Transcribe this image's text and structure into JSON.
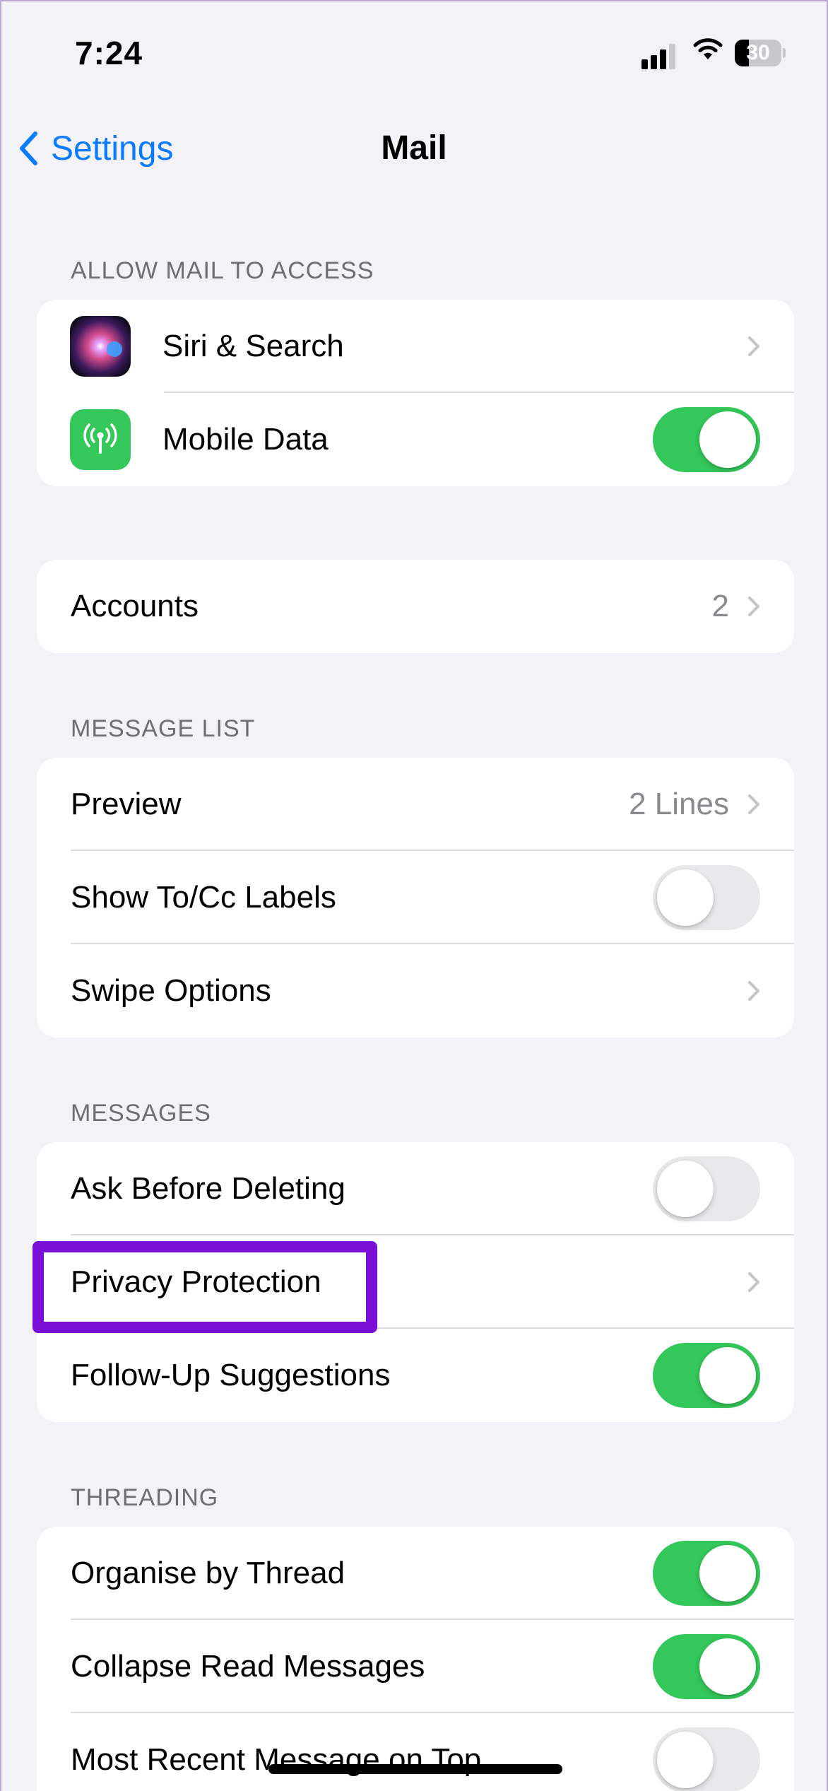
{
  "status_bar": {
    "time": "7:24",
    "battery_level": "30",
    "battery_fraction": 0.3,
    "signal_bars_active": 3,
    "signal_bars_total": 4
  },
  "nav": {
    "back_label": "Settings",
    "title": "Mail"
  },
  "sections": {
    "allow_access": {
      "header": "ALLOW MAIL TO ACCESS",
      "rows": [
        {
          "label": "Siri & Search",
          "icon": "siri-icon",
          "type": "chevron"
        },
        {
          "label": "Mobile Data",
          "icon": "antenna-icon",
          "type": "toggle",
          "on": true
        }
      ]
    },
    "accounts": {
      "rows": [
        {
          "label": "Accounts",
          "value": "2",
          "type": "chevron"
        }
      ]
    },
    "message_list": {
      "header": "MESSAGE LIST",
      "rows": [
        {
          "label": "Preview",
          "value": "2 Lines",
          "type": "chevron"
        },
        {
          "label": "Show To/Cc Labels",
          "type": "toggle",
          "on": false
        },
        {
          "label": "Swipe Options",
          "type": "chevron"
        }
      ]
    },
    "messages": {
      "header": "MESSAGES",
      "rows": [
        {
          "label": "Ask Before Deleting",
          "type": "toggle",
          "on": false
        },
        {
          "label": "Privacy Protection",
          "type": "chevron"
        },
        {
          "label": "Follow-Up Suggestions",
          "type": "toggle",
          "on": true
        }
      ]
    },
    "threading": {
      "header": "THREADING",
      "rows": [
        {
          "label": "Organise by Thread",
          "type": "toggle",
          "on": true
        },
        {
          "label": "Collapse Read Messages",
          "type": "toggle",
          "on": true
        },
        {
          "label": "Most Recent Message on Top",
          "type": "toggle",
          "on": false
        }
      ]
    }
  },
  "colors": {
    "accent": "#0a7aff",
    "toggle_on": "#34c759",
    "highlight": "#7a0fd6",
    "background": "#f2f2f7"
  }
}
